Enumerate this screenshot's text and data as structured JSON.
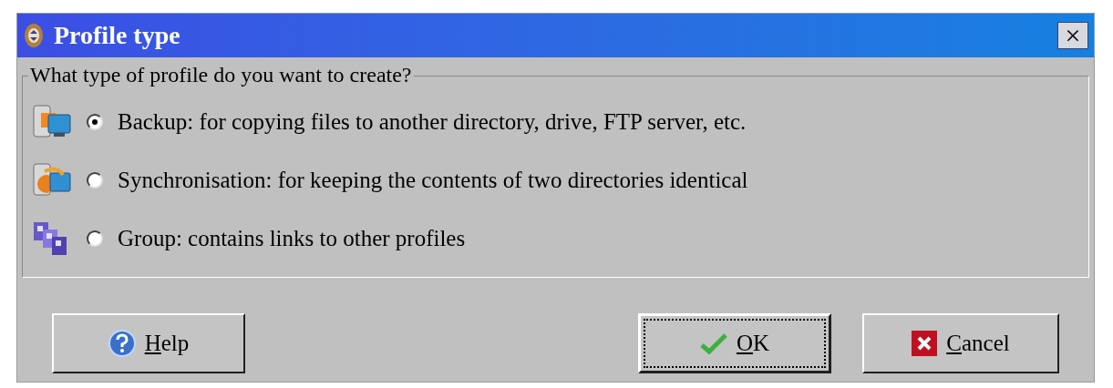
{
  "window": {
    "title": "Profile type",
    "close": "×"
  },
  "group": {
    "title": "What type of profile do you want to create?",
    "options": [
      {
        "kind": "backup",
        "label": "Backup: for copying files to another directory, drive, FTP server, etc.",
        "selected": true
      },
      {
        "kind": "sync",
        "label": "Synchronisation: for keeping the contents of two directories identical",
        "selected": false
      },
      {
        "kind": "group",
        "label": "Group: contains links to other profiles",
        "selected": false
      }
    ]
  },
  "buttons": [
    {
      "kind": "help",
      "label": "Help",
      "focused": false
    },
    {
      "kind": "ok",
      "label": "OK",
      "focused": true
    },
    {
      "kind": "cancel",
      "label": "Cancel",
      "focused": false
    }
  ]
}
